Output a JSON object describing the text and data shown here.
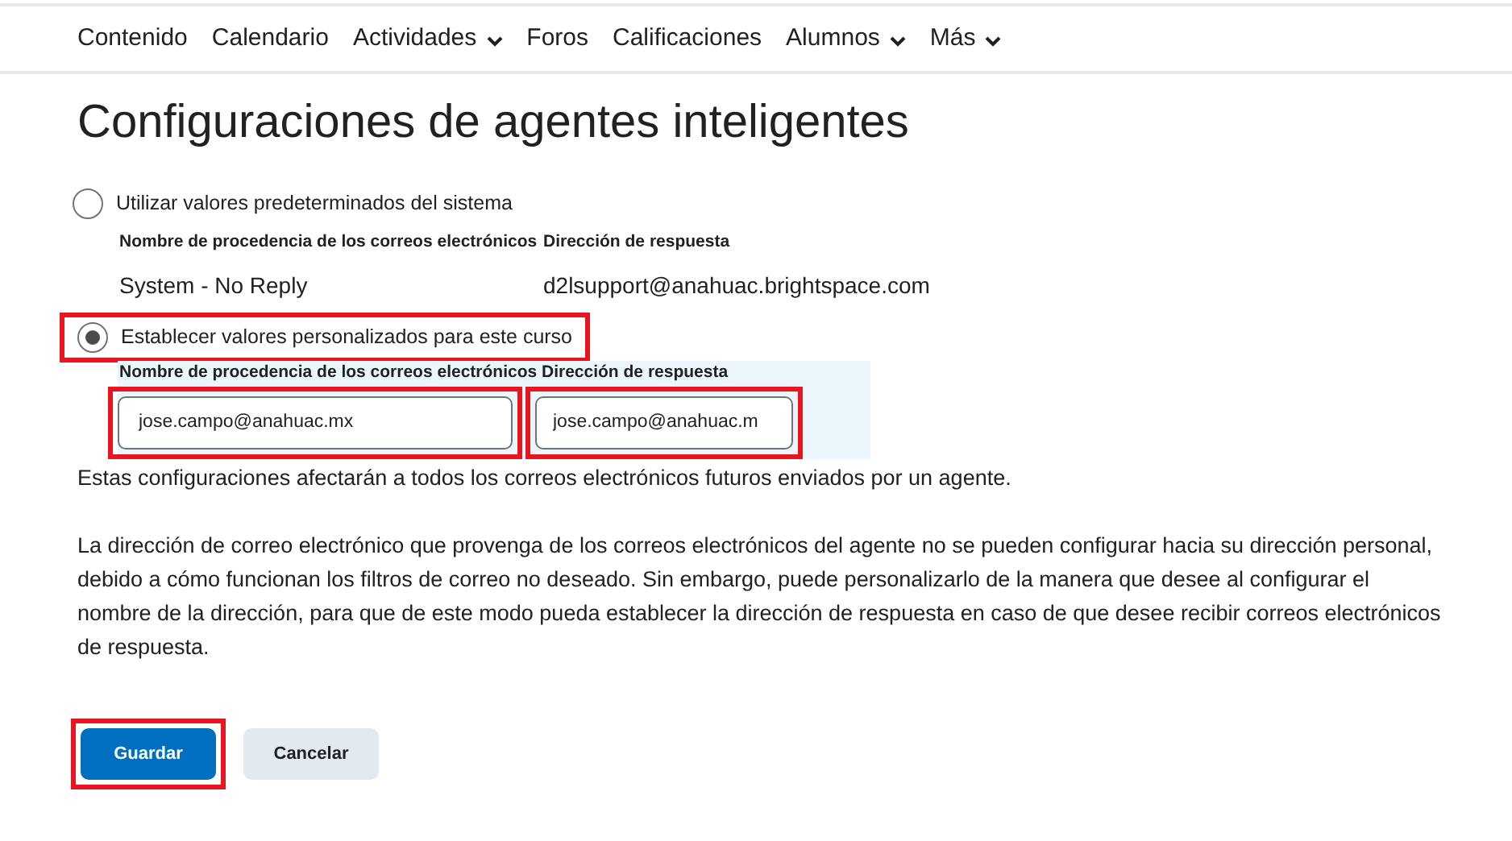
{
  "nav": [
    {
      "label": "Contenido",
      "dropdown": false
    },
    {
      "label": "Calendario",
      "dropdown": false
    },
    {
      "label": "Actividades",
      "dropdown": true
    },
    {
      "label": "Foros",
      "dropdown": false
    },
    {
      "label": "Calificaciones",
      "dropdown": false
    },
    {
      "label": "Alumnos",
      "dropdown": true
    },
    {
      "label": "Más",
      "dropdown": true
    }
  ],
  "title": "Configuraciones de agentes inteligentes",
  "options": [
    {
      "label": "Utilizar valores predeterminados del sistema",
      "selected": false,
      "highlighted": false,
      "kind": "static",
      "name_label": "Nombre de procedencia de los correos electrónicos",
      "reply_label": "Dirección de respuesta",
      "name_value": "System - No Reply",
      "reply_value": "d2lsupport@anahuac.brightspace.com"
    },
    {
      "label": "Establecer valores personalizados para este curso",
      "selected": true,
      "highlighted": true,
      "kind": "fields",
      "name_label": "Nombre de procedencia de los correos electrónicos",
      "reply_label": "Dirección de respuesta",
      "name_value": "jose.campo@anahuac.mx",
      "reply_value": "jose.campo@anahuac.m",
      "name_highlighted": true,
      "reply_highlighted": true
    }
  ],
  "note": "Estas configuraciones afectarán a todos los correos electrónicos futuros enviados por un agente.",
  "paragraph": "La dirección de correo electrónico que provenga de los correos electrónicos del agente no se pueden configurar hacia su dirección personal, debido a cómo funcionan los filtros de correo no deseado. Sin embargo, puede personalizarlo de la manera que desee al configurar el nombre de la dirección, para que de este modo pueda establecer la dirección de respuesta en caso de que desee recibir correos electrónicos de respuesta.",
  "buttons": [
    {
      "label": "Guardar",
      "kind": "primary",
      "highlighted": true
    },
    {
      "label": "Cancelar",
      "kind": "secondary",
      "highlighted": false
    }
  ]
}
